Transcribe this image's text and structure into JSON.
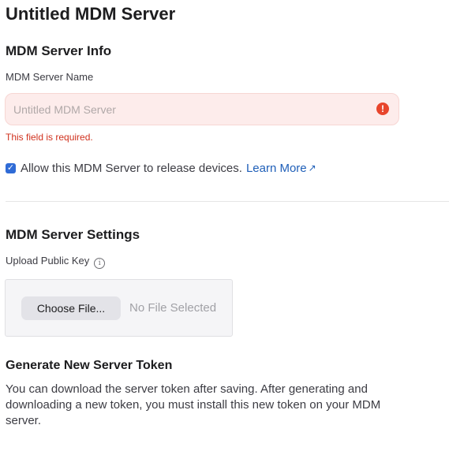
{
  "page": {
    "title": "Untitled MDM Server"
  },
  "info_section": {
    "title": "MDM Server Info",
    "name_label": "MDM Server Name",
    "name_placeholder": "Untitled MDM Server",
    "name_value": "",
    "error_icon": "exclamation-circle-icon",
    "error_text": "This field is required.",
    "allow_release": {
      "checked": true,
      "label": "Allow this MDM Server to release devices.",
      "link_text": "Learn More",
      "link_icon": "↗"
    }
  },
  "settings_section": {
    "title": "MDM Server Settings",
    "upload_label": "Upload Public Key",
    "info_icon": "ⓘ",
    "choose_button": "Choose File...",
    "no_file_text": "No File Selected"
  },
  "token_section": {
    "title": "Generate New Server Token",
    "description": "You can download the server token after saving. After generating and downloading a new token, you must install this new token on your MDM server."
  },
  "colors": {
    "error": "#d0311e",
    "error_field_bg": "#fdeceb",
    "link": "#1f5fb8",
    "checkbox": "#2f6bd6"
  }
}
